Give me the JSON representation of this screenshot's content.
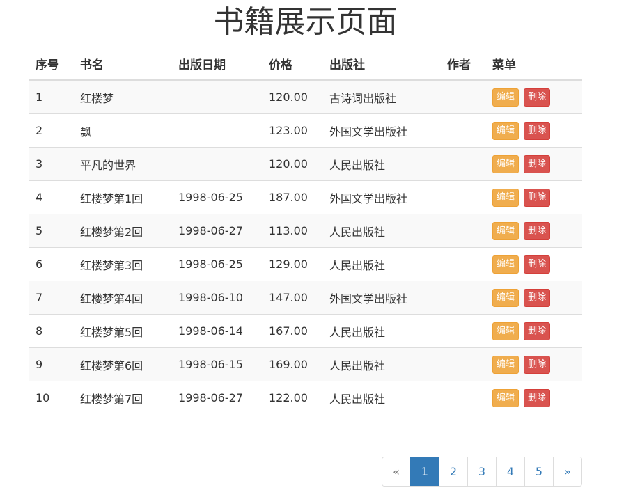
{
  "page": {
    "title": "书籍展示页面"
  },
  "table": {
    "headers": [
      "序号",
      "书名",
      "出版日期",
      "价格",
      "出版社",
      "作者",
      "菜单"
    ],
    "rows": [
      {
        "id": "1",
        "name": "红楼梦",
        "date": "",
        "price": "120.00",
        "publisher": "古诗词出版社",
        "author": ""
      },
      {
        "id": "2",
        "name": "飘",
        "date": "",
        "price": "123.00",
        "publisher": "外国文学出版社",
        "author": ""
      },
      {
        "id": "3",
        "name": "平凡的世界",
        "date": "",
        "price": "120.00",
        "publisher": "人民出版社",
        "author": ""
      },
      {
        "id": "4",
        "name": "红楼梦第1回",
        "date": "1998-06-25",
        "price": "187.00",
        "publisher": "外国文学出版社",
        "author": ""
      },
      {
        "id": "5",
        "name": "红楼梦第2回",
        "date": "1998-06-27",
        "price": "113.00",
        "publisher": "人民出版社",
        "author": ""
      },
      {
        "id": "6",
        "name": "红楼梦第3回",
        "date": "1998-06-25",
        "price": "129.00",
        "publisher": "人民出版社",
        "author": ""
      },
      {
        "id": "7",
        "name": "红楼梦第4回",
        "date": "1998-06-10",
        "price": "147.00",
        "publisher": "外国文学出版社",
        "author": ""
      },
      {
        "id": "8",
        "name": "红楼梦第5回",
        "date": "1998-06-14",
        "price": "167.00",
        "publisher": "人民出版社",
        "author": ""
      },
      {
        "id": "9",
        "name": "红楼梦第6回",
        "date": "1998-06-15",
        "price": "169.00",
        "publisher": "人民出版社",
        "author": ""
      },
      {
        "id": "10",
        "name": "红楼梦第7回",
        "date": "1998-06-27",
        "price": "122.00",
        "publisher": "人民出版社",
        "author": ""
      }
    ],
    "edit_label": "编辑",
    "delete_label": "删除"
  },
  "pagination": {
    "prev": "«",
    "next": "»",
    "pages": [
      "1",
      "2",
      "3",
      "4",
      "5"
    ],
    "active": "1"
  },
  "colors": {
    "edit": "#f0ad4e",
    "delete": "#d9534f",
    "primary": "#337ab7",
    "stripe": "#f9f9f9",
    "border": "#dddddd"
  }
}
